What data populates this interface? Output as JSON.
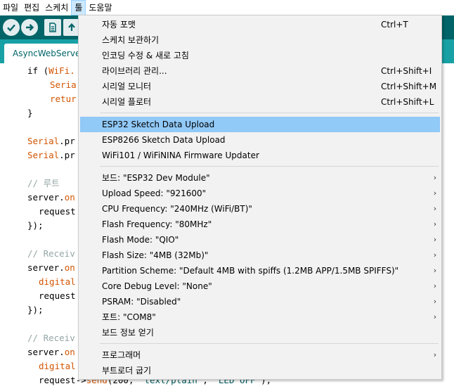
{
  "menubar": {
    "items": [
      "파일",
      "편집",
      "스케치",
      "툴",
      "도움말"
    ]
  },
  "tab": {
    "label": "AsyncWebServer"
  },
  "code": {
    "l1a": "if (",
    "l1b": "WiFi.",
    "l2": "Seria",
    "l3": "retur",
    "l4": "}",
    "l5a": "Serial",
    "l5b": ".pr",
    "l6a": "Serial",
    "l6b": ".pr",
    "l7": "// 루트",
    "l8a": "server.",
    "l8b": "on",
    "l9": "request",
    "l10": "});",
    "l11": "// Receiv",
    "l12a": "server.",
    "l12b": "on",
    "l13": "digital",
    "l14": "request",
    "l15": "});",
    "l16": "// Receiv",
    "l17a": "server.",
    "l17b": "on",
    "l18": "digital",
    "l19a": "request->",
    "l19b": "send",
    "l19c": "(200, ",
    "l19d": "\"text/plain\"",
    "l19e": ", ",
    "l19f": "\"LED OFF\"",
    "l19g": ");"
  },
  "menu": {
    "items": [
      {
        "label": "자동 포맷",
        "shortcut": "Ctrl+T"
      },
      {
        "label": "스케치 보관하기",
        "shortcut": ""
      },
      {
        "label": "인코딩 수정 & 새로 고침",
        "shortcut": ""
      },
      {
        "label": "라이브러리 관리...",
        "shortcut": "Ctrl+Shift+I"
      },
      {
        "label": "시리얼 모니터",
        "shortcut": "Ctrl+Shift+M"
      },
      {
        "label": "시리얼 플로터",
        "shortcut": "Ctrl+Shift+L"
      },
      {
        "label": "ESP32 Sketch Data Upload",
        "shortcut": ""
      },
      {
        "label": "ESP8266 Sketch Data Upload",
        "shortcut": ""
      },
      {
        "label": "WiFi101 / WiFiNINA Firmware Updater",
        "shortcut": ""
      },
      {
        "label": "보드: \"ESP32 Dev Module\"",
        "shortcut": ""
      },
      {
        "label": "Upload Speed: \"921600\"",
        "shortcut": ""
      },
      {
        "label": "CPU Frequency: \"240MHz (WiFi/BT)\"",
        "shortcut": ""
      },
      {
        "label": "Flash Frequency: \"80MHz\"",
        "shortcut": ""
      },
      {
        "label": "Flash Mode: \"QIO\"",
        "shortcut": ""
      },
      {
        "label": "Flash Size: \"4MB (32Mb)\"",
        "shortcut": ""
      },
      {
        "label": "Partition Scheme: \"Default 4MB with spiffs (1.2MB APP/1.5MB SPIFFS)\"",
        "shortcut": ""
      },
      {
        "label": "Core Debug Level: \"None\"",
        "shortcut": ""
      },
      {
        "label": "PSRAM: \"Disabled\"",
        "shortcut": ""
      },
      {
        "label": "포트: \"COM8\"",
        "shortcut": ""
      },
      {
        "label": "보드 정보 얻기",
        "shortcut": ""
      },
      {
        "label": "프로그래머",
        "shortcut": ""
      },
      {
        "label": "부트로더 굽기",
        "shortcut": ""
      }
    ],
    "submenu_arrow": "›"
  },
  "colors": {
    "toolbar": "#006468",
    "tabstrip": "#17a1a5",
    "menu_highlight": "#91c9f7",
    "keyword": "#d35400",
    "comment": "#95a5a6"
  }
}
